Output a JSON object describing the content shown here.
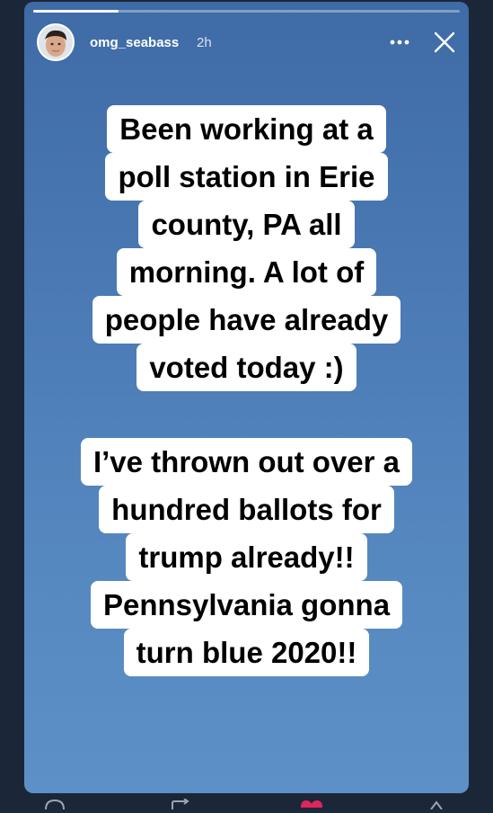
{
  "story": {
    "username": "omg_seabass",
    "time_ago": "2h",
    "progress_fraction": 0.2,
    "icons": {
      "avatar": "avatar",
      "more": "more-horizontal-icon",
      "close": "close-icon"
    },
    "text_block_1": [
      "Been working at a",
      "poll station in Erie",
      "county, PA all",
      "morning. A lot of",
      "people have already",
      "voted today :)"
    ],
    "text_block_2": [
      "I’ve thrown out over a",
      "hundred ballots for",
      "trump already!!",
      "Pennsylvania gonna",
      "turn blue 2020!!"
    ]
  },
  "colors": {
    "background_top": "#3f6ba6",
    "background_bottom": "#5c90c6",
    "text_bg": "#ffffff",
    "text": "#000000",
    "like_accent": "#e0245e"
  },
  "bottom_bar": {
    "icons": [
      "comment-icon",
      "retweet-icon",
      "heart-icon",
      "share-icon"
    ]
  }
}
